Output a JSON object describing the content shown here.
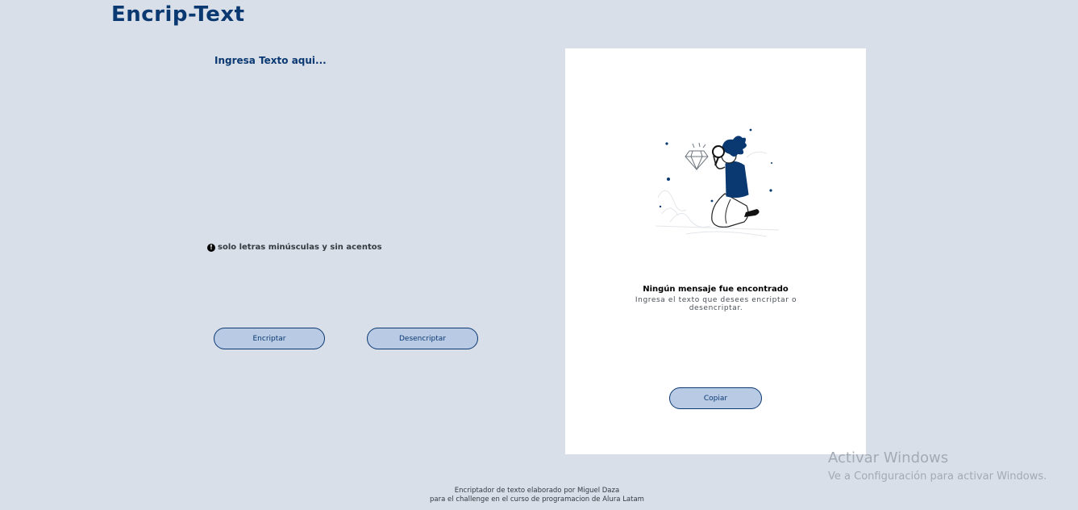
{
  "app": {
    "logo_text": "Encrip-Text"
  },
  "input": {
    "placeholder": "Ingresa Texto aqui...",
    "value": ""
  },
  "hint": {
    "icon": "exclamation-circle-icon",
    "text": "solo letras minúsculas y sin acentos"
  },
  "buttons": {
    "encrypt_label": "Encriptar",
    "decrypt_label": "Desencriptar",
    "copy_label": "Copiar"
  },
  "output": {
    "title": "Ningún mensaje fue encontrado",
    "subtitle": "Ingresa el texto que desees encriptar o desencriptar.",
    "illustration": "person-with-magnifier-and-diamond"
  },
  "footer": {
    "line1": "Encriptador de texto elaborado por Miguel Daza",
    "line2": "para el challenge en el curso de programacion de Alura Latam"
  },
  "watermark": {
    "title": "Activar Windows",
    "subtitle": "Ve a Configuración para activar Windows."
  },
  "colors": {
    "background": "#d8dfe9",
    "primary": "#0a3871",
    "button_fill": "#b8cae4",
    "panel": "#ffffff"
  }
}
